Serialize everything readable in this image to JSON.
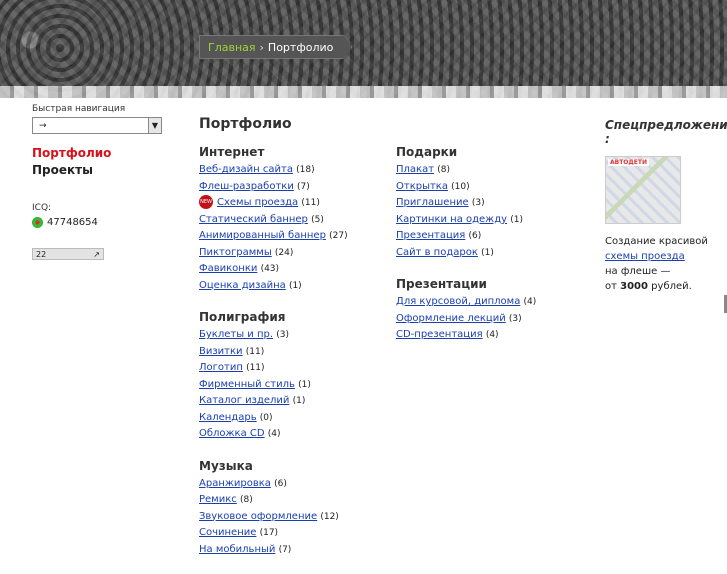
{
  "breadcrumb": {
    "home": "Главная",
    "separator": "›",
    "current": "Портфолио"
  },
  "left": {
    "quick_nav_label": "Быстрая навигация",
    "quick_nav_value": "→",
    "menu_portfolio": "Портфолио",
    "menu_projects": "Проекты",
    "icq_label": "ICQ:",
    "icq_number": "47748654",
    "counter_value": "22",
    "counter_arrow": "↗"
  },
  "page_title": "Портфолио",
  "sections_col1": [
    {
      "title": "Интернет",
      "items": [
        {
          "label": "Веб-дизайн сайта",
          "count": "(18)"
        },
        {
          "label": "Флеш-разработки",
          "count": "(7)"
        },
        {
          "label": "Схемы проезда",
          "count": "(11)",
          "badge": "new"
        },
        {
          "label": "Статический баннер",
          "count": "(5)"
        },
        {
          "label": "Анимированный баннер",
          "count": "(27)"
        },
        {
          "label": "Пиктограммы",
          "count": "(24)"
        },
        {
          "label": "Фавиконки",
          "count": "(43)"
        },
        {
          "label": "Оценка дизайна",
          "count": "(1)"
        }
      ]
    },
    {
      "title": "Полиграфия",
      "items": [
        {
          "label": "Буклеты и пр.",
          "count": "(3)"
        },
        {
          "label": "Визитки",
          "count": "(11)"
        },
        {
          "label": "Логотип",
          "count": "(11)"
        },
        {
          "label": "Фирменный стиль",
          "count": "(1)"
        },
        {
          "label": "Каталог изделий",
          "count": "(1)"
        },
        {
          "label": "Календарь",
          "count": "(0)"
        },
        {
          "label": "Обложка CD",
          "count": "(4)"
        }
      ]
    },
    {
      "title": "Музыка",
      "items": [
        {
          "label": "Аранжировка",
          "count": "(6)"
        },
        {
          "label": "Ремикс",
          "count": "(8)"
        },
        {
          "label": "Звуковое оформление",
          "count": "(12)"
        },
        {
          "label": "Сочинение",
          "count": "(17)"
        },
        {
          "label": "На мобильный",
          "count": "(7)"
        }
      ]
    }
  ],
  "sections_col2": [
    {
      "title": "Подарки",
      "items": [
        {
          "label": "Плакат",
          "count": "(8)"
        },
        {
          "label": "Открытка",
          "count": "(10)"
        },
        {
          "label": "Приглашение",
          "count": "(3)"
        },
        {
          "label": "Картинки на одежду",
          "count": "(1)"
        },
        {
          "label": "Презентация",
          "count": "(6)"
        },
        {
          "label": "Сайт в подарок",
          "count": "(1)"
        }
      ]
    },
    {
      "title": "Презентации",
      "items": [
        {
          "label": "Для курсовой, диплома",
          "count": "(4)"
        },
        {
          "label": "Оформление лекций",
          "count": "(3)"
        },
        {
          "label": "CD-презентация",
          "count": "(4)"
        }
      ]
    }
  ],
  "special": {
    "heading": "Спецпредложения",
    "heading_colon": ":",
    "thumb_label": "АВТОДЕТИ",
    "text_1": "Создание красивой",
    "link": "схемы проезда",
    "text_2": "на флеше —",
    "text_3_prefix": "от",
    "price": "3000",
    "text_3_suffix": "рублей."
  },
  "new_badge_text": "NEW"
}
